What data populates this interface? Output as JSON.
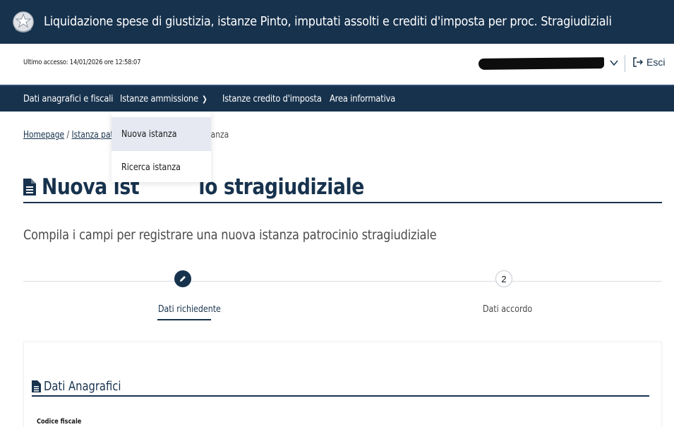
{
  "header": {
    "title": "Liquidazione spese di giustizia, istanze Pinto, imputati assolti e crediti d'imposta per proc. Stragiudiziali",
    "emblem_icon": "italian-republic-emblem",
    "background": "#17324d"
  },
  "subheader": {
    "last_access": "Ultimo accesso: 14/01/2026 ore 12:58:07",
    "logout_label": "Esci"
  },
  "nav": {
    "items": [
      {
        "label": "Dati anagrafici e fiscali"
      },
      {
        "label": "Istanze ammissione"
      },
      {
        "label": "Istanze credito d'imposta"
      },
      {
        "label": "Area informativa"
      }
    ]
  },
  "dropdown": {
    "items": [
      {
        "label": "Nuova istanza"
      },
      {
        "label": "Ricerca istanza"
      }
    ]
  },
  "breadcrumb": {
    "home": "Homepage",
    "separator": "/",
    "istanza": "Istanza patroc",
    "current_tail": "anza"
  },
  "page": {
    "title_left": "Nuova ist",
    "title_right": "io stragiudiziale",
    "subtitle": "Compila i campi per registrare una nuova istanza patrocinio stragiudiziale"
  },
  "stepper": {
    "steps": [
      {
        "number": "",
        "label": "Dati richiedente",
        "state": "active",
        "icon": "pencil-icon"
      },
      {
        "number": "2",
        "label": "Dati accordo",
        "state": "inactive"
      }
    ]
  },
  "form": {
    "section_title": "Dati Anagrafici",
    "fields": [
      {
        "label": "Codice fiscale"
      }
    ]
  },
  "colors": {
    "primary": "#17324d",
    "dropdown_active_bg": "#e6e9f2"
  }
}
